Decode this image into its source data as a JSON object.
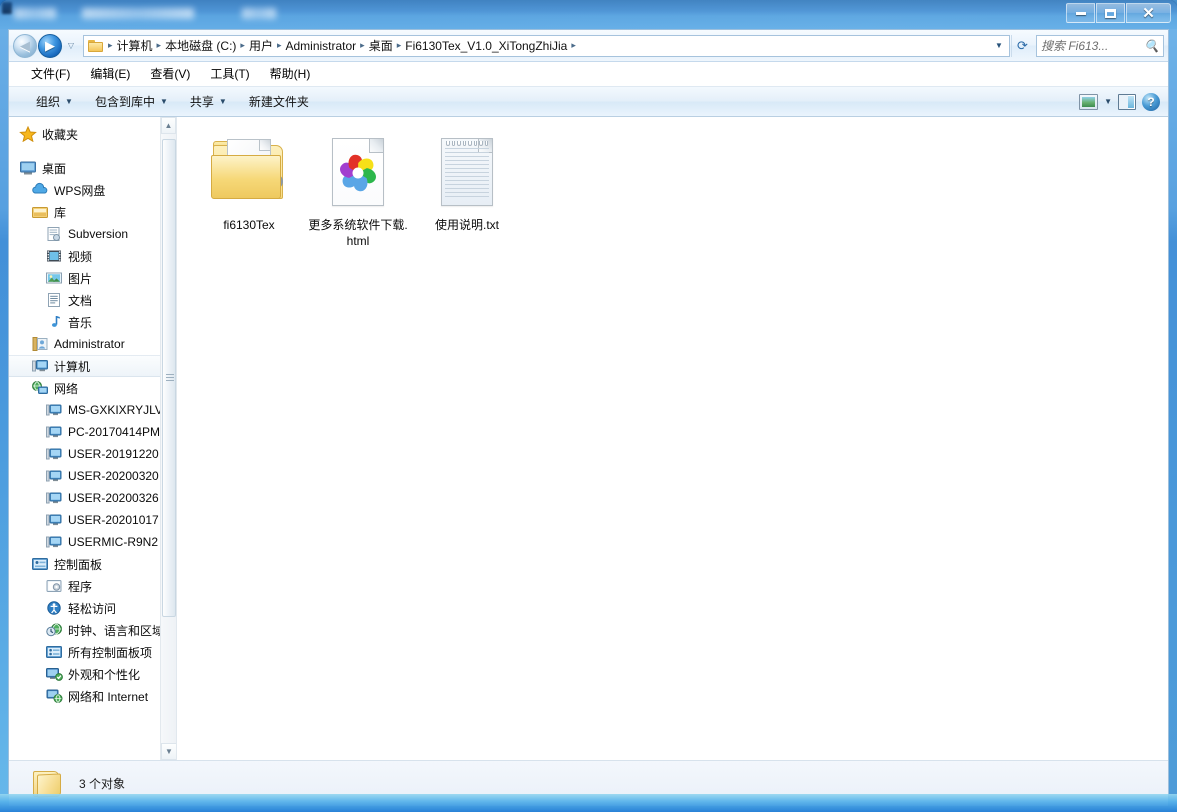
{
  "window": {
    "title_obscured": true,
    "min_label": "最小化",
    "max_label": "最大化",
    "close_label": "关闭"
  },
  "nav": {
    "back_label": "后退",
    "forward_label": "前进",
    "recent_label": "最近访问的位置",
    "dropdown_label": "以前的位置",
    "refresh_label": "刷新",
    "breadcrumbs": [
      "计算机",
      "本地磁盘 (C:)",
      "用户",
      "Administrator",
      "桌面",
      "Fi6130Tex_V1.0_XiTongZhiJia"
    ],
    "separator": "▸"
  },
  "search": {
    "placeholder": "搜索 Fi613...",
    "icon": "search-icon"
  },
  "menu": {
    "items": [
      {
        "label": "文件(F)",
        "name": "menu-file"
      },
      {
        "label": "编辑(E)",
        "name": "menu-edit"
      },
      {
        "label": "查看(V)",
        "name": "menu-view"
      },
      {
        "label": "工具(T)",
        "name": "menu-tools"
      },
      {
        "label": "帮助(H)",
        "name": "menu-help"
      }
    ]
  },
  "toolbar": {
    "organize": "组织",
    "include_in_library": "包含到库中",
    "share": "共享",
    "new_folder": "新建文件夹",
    "caret": "▼",
    "view_icon": "view-layout-icon",
    "view_caret": "▼",
    "preview_pane_icon": "preview-pane-icon",
    "help_icon": "help-icon",
    "help_glyph": "?"
  },
  "sidebar": {
    "items": [
      {
        "label": "收藏夹",
        "icon": "star-icon",
        "indent": 0,
        "selected": false
      },
      {
        "label": "桌面",
        "icon": "desktop-icon",
        "indent": 0,
        "selected": false
      },
      {
        "label": "WPS网盘",
        "icon": "cloud-icon",
        "indent": 1,
        "selected": false
      },
      {
        "label": "库",
        "icon": "library-icon",
        "indent": 1,
        "selected": false
      },
      {
        "label": "Subversion",
        "icon": "subversion-icon",
        "indent": 2,
        "selected": false
      },
      {
        "label": "视频",
        "icon": "video-icon",
        "indent": 2,
        "selected": false
      },
      {
        "label": "图片",
        "icon": "pictures-icon",
        "indent": 2,
        "selected": false
      },
      {
        "label": "文档",
        "icon": "documents-icon",
        "indent": 2,
        "selected": false
      },
      {
        "label": "音乐",
        "icon": "music-icon",
        "indent": 2,
        "selected": false
      },
      {
        "label": "Administrator",
        "icon": "user-icon",
        "indent": 1,
        "selected": false
      },
      {
        "label": "计算机",
        "icon": "computer-icon",
        "indent": 1,
        "selected": true
      },
      {
        "label": "网络",
        "icon": "network-icon",
        "indent": 1,
        "selected": false
      },
      {
        "label": "MS-GXKIXRYJLV",
        "icon": "network-computer-icon",
        "indent": 2,
        "selected": false
      },
      {
        "label": "PC-20170414PM",
        "icon": "network-computer-icon",
        "indent": 2,
        "selected": false
      },
      {
        "label": "USER-20191220",
        "icon": "network-computer-icon",
        "indent": 2,
        "selected": false
      },
      {
        "label": "USER-20200320",
        "icon": "network-computer-icon",
        "indent": 2,
        "selected": false
      },
      {
        "label": "USER-20200326",
        "icon": "network-computer-icon",
        "indent": 2,
        "selected": false
      },
      {
        "label": "USER-20201017",
        "icon": "network-computer-icon",
        "indent": 2,
        "selected": false
      },
      {
        "label": "USERMIC-R9N2",
        "icon": "network-computer-icon",
        "indent": 2,
        "selected": false
      },
      {
        "label": "控制面板",
        "icon": "control-panel-icon",
        "indent": 1,
        "selected": false
      },
      {
        "label": "程序",
        "icon": "programs-icon",
        "indent": 2,
        "selected": false
      },
      {
        "label": "轻松访问",
        "icon": "ease-of-access-icon",
        "indent": 2,
        "selected": false
      },
      {
        "label": "时钟、语言和区域",
        "icon": "clock-region-icon",
        "indent": 2,
        "selected": false
      },
      {
        "label": "所有控制面板项",
        "icon": "all-items-icon",
        "indent": 2,
        "selected": false
      },
      {
        "label": "外观和个性化",
        "icon": "appearance-icon",
        "indent": 2,
        "selected": false
      },
      {
        "label": "网络和 Internet",
        "icon": "network-internet-icon",
        "indent": 2,
        "selected": false
      }
    ],
    "scroll_up": "▲",
    "scroll_down": "▼"
  },
  "files": [
    {
      "name": "fi6130Tex",
      "type": "folder",
      "icon": "folder-with-gears-icon"
    },
    {
      "name": "更多系统软件下载.html",
      "type": "html",
      "icon": "pinwheel-browser-icon"
    },
    {
      "name": "使用说明.txt",
      "type": "text",
      "icon": "notepad-text-icon"
    }
  ],
  "status": {
    "icon": "folder-icon",
    "text": "3 个对象"
  },
  "colors": {
    "accent": "#2b6fc0",
    "window_chrome": "#eaf3fc",
    "selection": "#cde6f7",
    "petal_blue": "#4f9fe0",
    "petal_purple": "#a43fd0",
    "petal_red": "#e02b22",
    "petal_yellow": "#f5df1a",
    "petal_green": "#29b34a"
  }
}
